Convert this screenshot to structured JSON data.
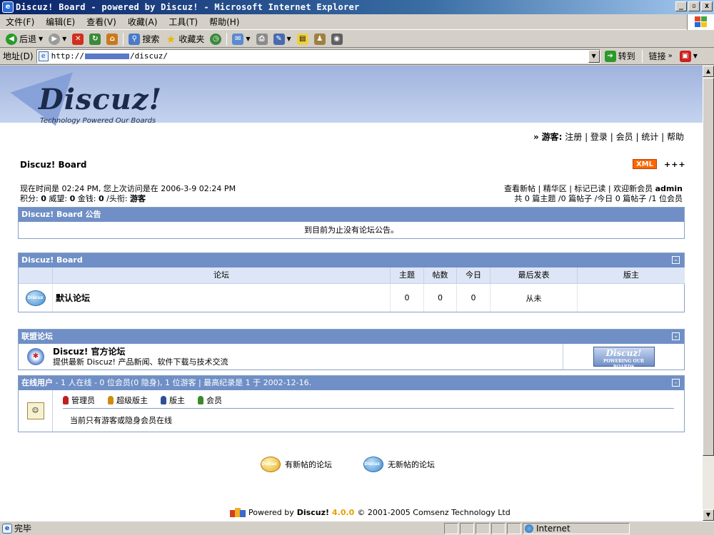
{
  "window": {
    "title": "Discuz! Board - powered by Discuz! - Microsoft Internet Explorer",
    "controls": [
      "_",
      "▫",
      "x"
    ]
  },
  "menubar": [
    "文件(F)",
    "编辑(E)",
    "查看(V)",
    "收藏(A)",
    "工具(T)",
    "帮助(H)"
  ],
  "toolbar": {
    "back": "后退",
    "search": "搜索",
    "favorites": "收藏夹"
  },
  "address": {
    "label": "地址(D)",
    "url_prefix": "http://",
    "url_suffix": "/discuz/",
    "go": "转到",
    "links": "链接"
  },
  "status": {
    "text": "完毕",
    "zone": "Internet"
  },
  "page": {
    "logo": {
      "word": "Discuz!",
      "tagline": "Technology Powered Our Boards"
    },
    "guest_links": {
      "prefix": "»",
      "guest": "游客:",
      "items": [
        "注册",
        "登录",
        "会员",
        "统计",
        "帮助"
      ]
    },
    "board_title": "Discuz! Board",
    "xml_badge": "XML",
    "expand_marks": "+++",
    "info": {
      "line1": "现在时间是  02:24 PM, 您上次访问是在  2006-3-9 02:24 PM",
      "line2_parts": [
        "积分:",
        "0",
        "威望:",
        "0",
        "金钱:",
        "0",
        "/头衔:",
        "游客"
      ]
    },
    "quick_links": {
      "items": [
        "查看新帖",
        "精华区",
        "标记已读",
        "欢迎新会员"
      ],
      "newest_member": "admin",
      "stats": "共 0 篇主题 /0 篇帖子 /今日 0 篇帖子 /1 位会员"
    },
    "announcement": {
      "caption": "Discuz! Board 公告",
      "body": "到目前为止没有论坛公告。"
    },
    "forum_list": {
      "caption": "Discuz! Board",
      "headers": [
        "",
        "论坛",
        "主题",
        "帖数",
        "今日",
        "最后发表",
        "版主"
      ],
      "rows": [
        {
          "icon": "Discuz",
          "name": "默认论坛",
          "threads": "0",
          "posts": "0",
          "today": "0",
          "last": "从未",
          "moderator": ""
        }
      ]
    },
    "alliance": {
      "caption": "联盟论坛",
      "name": "Discuz! 官方论坛",
      "desc": "提供最新 Discuz! 产品新闻、软件下载与技术交流",
      "banner_word": "Discuz!",
      "banner_sub": "POWERING OUR BOARDS"
    },
    "online": {
      "caption_label": "在线用户",
      "caption_stats": "- 1 人在线 - 0 位会员(0 隐身), 1 位游客 | 最高纪录是  1 于  2002-12-16.",
      "legend": [
        "管理员",
        "超级版主",
        "版主",
        "会员"
      ],
      "legend_colors": [
        "#c0201e",
        "#d08a10",
        "#2e4f96",
        "#3a8a2a"
      ],
      "message": "当前只有游客或隐身会员在线"
    },
    "keys": {
      "new_posts": "有新帖的论坛",
      "no_new_posts": "无新帖的论坛",
      "icon_text": "Discuz"
    },
    "footer": {
      "powered": "Powered by",
      "brand": "Discuz!",
      "version": "4.0.0",
      "copyright": "© 2001-2005 Comsenz Technology Ltd"
    }
  }
}
